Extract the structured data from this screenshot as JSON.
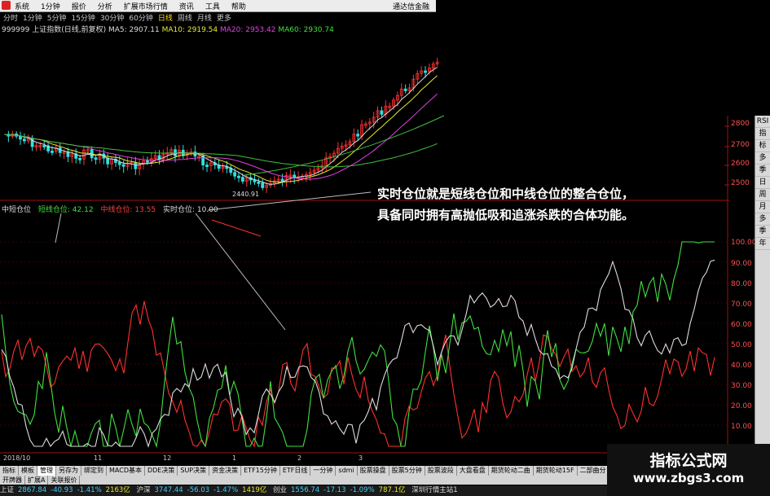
{
  "menubar": {
    "items": [
      "系统",
      "1分钟",
      "报价",
      "分析",
      "扩展市场行情",
      "资讯",
      "工具",
      "帮助"
    ],
    "brand": "通达信金融"
  },
  "periods": [
    "分时",
    "1分钟",
    "5分钟",
    "15分钟",
    "30分钟",
    "60分钟",
    "日线",
    "周线",
    "月线",
    "更多"
  ],
  "active_period": "日线",
  "main_indicator": {
    "title": "999999 上证指数(日线,前复权)",
    "ma5": "MA5: 2907.11",
    "ma10": "MA10: 2919.54",
    "ma20": "MA20: 2953.42",
    "ma60": "MA60: 2930.74",
    "low_label": "2440.91"
  },
  "price_axis": [
    "2800",
    "2700",
    "2600",
    "2500"
  ],
  "sub_indicator": {
    "title": "中短仓位",
    "short_label": "短线仓位: 42.12",
    "mid_label": "中线仓位: 13.55",
    "real_label": "实时仓位: 10.00"
  },
  "annotation": {
    "line1": "实时仓位就是短线仓位和中线仓位的整合仓位，",
    "line2": "具备同时拥有高抛低吸和追涨杀跌的合体功能。"
  },
  "sub_axis": [
    "100.00",
    "90.00",
    "80.00",
    "70.00",
    "60.00",
    "50.00",
    "40.00",
    "30.00",
    "20.00",
    "10.00"
  ],
  "sidebar": [
    "RSI",
    "指",
    "标",
    "多",
    "季",
    "日",
    "周",
    "月",
    "多",
    "季",
    "年"
  ],
  "dates": [
    "2018/10",
    "11",
    "12",
    "1",
    "2",
    "3"
  ],
  "tabs": [
    "指标",
    "模板",
    "管理",
    "另存为",
    "绑定到",
    "MACD基本",
    "DDE决策",
    "SUP决策",
    "资金决策",
    "ETF15分钟",
    "ETF日线",
    "一分钟",
    "sdmi",
    "股票操盘",
    "股票5分钟",
    "股票波段",
    "大盘看盘",
    "期货轮动二曲",
    "期货轮动15F",
    "二部曲分"
  ],
  "active_tab": "管理",
  "tabs2": [
    "开牌器",
    "扩展A",
    "关联报价"
  ],
  "status": {
    "sh_label": "上证",
    "sh_value": "2867.84",
    "sh_change": "-40.93",
    "sh_pct": "-1.41%",
    "sh_vol": "2163亿",
    "hs_label": "沪深",
    "hs_value": "3747.44",
    "hs_change": "-56.03",
    "hs_pct": "-1.47%",
    "hs_vol": "1419亿",
    "cy_label": "创业",
    "cy_value": "1556.74",
    "cy_change": "-17.13",
    "cy_pct": "-1.09%",
    "cy_vol": "787.1亿",
    "right_text": "深圳行情主站1"
  },
  "watermark": {
    "line1": "指标公式网",
    "line2": "www.zbgs3.com"
  },
  "colors": {
    "up": "#ff3030",
    "down": "#30e0e0",
    "short": "#40e040",
    "mid": "#ff3030",
    "real": "#dddddd"
  }
}
